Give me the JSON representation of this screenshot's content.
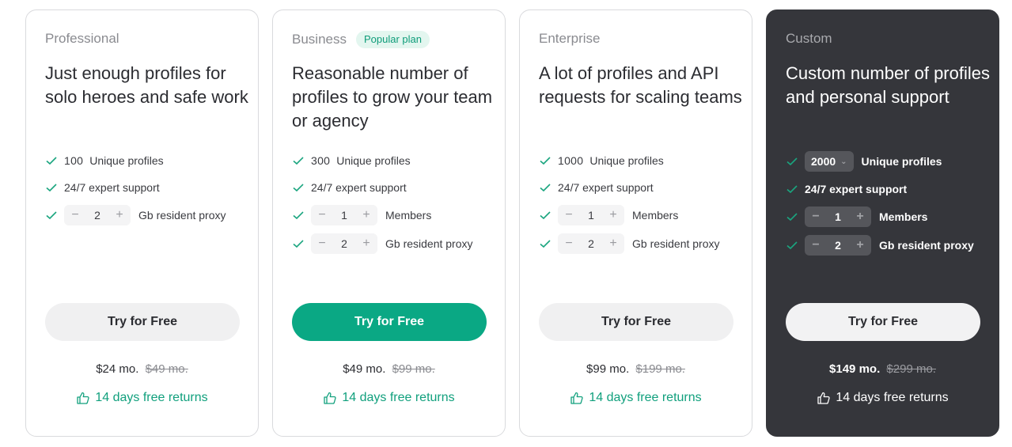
{
  "colors": {
    "accent": "#0aa884",
    "dark_card": "#35363b",
    "check": "#1aa57f"
  },
  "plans": [
    {
      "name": "Professional",
      "headline": "Just enough profiles for solo heroes and safe work",
      "profiles": "100",
      "profiles_label": "Unique profiles",
      "support": "24/7 expert support",
      "proxy_value": "2",
      "proxy_label": "Gb resident proxy",
      "cta": "Try for Free",
      "price": "$24 mo.",
      "old_price": "$49 mo.",
      "returns": "14 days free returns"
    },
    {
      "name": "Business",
      "badge": "Popular plan",
      "headline": "Reasonable number of profiles to grow your team or agency",
      "profiles": "300",
      "profiles_label": "Unique profiles",
      "support": "24/7 expert support",
      "members_value": "1",
      "members_label": "Members",
      "proxy_value": "2",
      "proxy_label": "Gb resident proxy",
      "cta": "Try for Free",
      "price": "$49 mo.",
      "old_price": "$99 mo.",
      "returns": "14 days free returns"
    },
    {
      "name": "Enterprise",
      "headline": "A lot of profiles and API requests for scaling teams",
      "profiles": "1000",
      "profiles_label": "Unique profiles",
      "support": "24/7 expert support",
      "members_value": "1",
      "members_label": "Members",
      "proxy_value": "2",
      "proxy_label": "Gb resident proxy",
      "cta": "Try for Free",
      "price": "$99 mo.",
      "old_price": "$199 mo.",
      "returns": "14 days free returns"
    },
    {
      "name": "Custom",
      "headline": "Custom number of profiles and personal support",
      "profiles": "2000",
      "profiles_label": "Unique profiles",
      "support": "24/7 expert support",
      "members_value": "1",
      "members_label": "Members",
      "proxy_value": "2",
      "proxy_label": "Gb resident proxy",
      "cta": "Try for Free",
      "price": "$149 mo.",
      "old_price": "$299 mo.",
      "returns": "14 days free returns"
    }
  ]
}
